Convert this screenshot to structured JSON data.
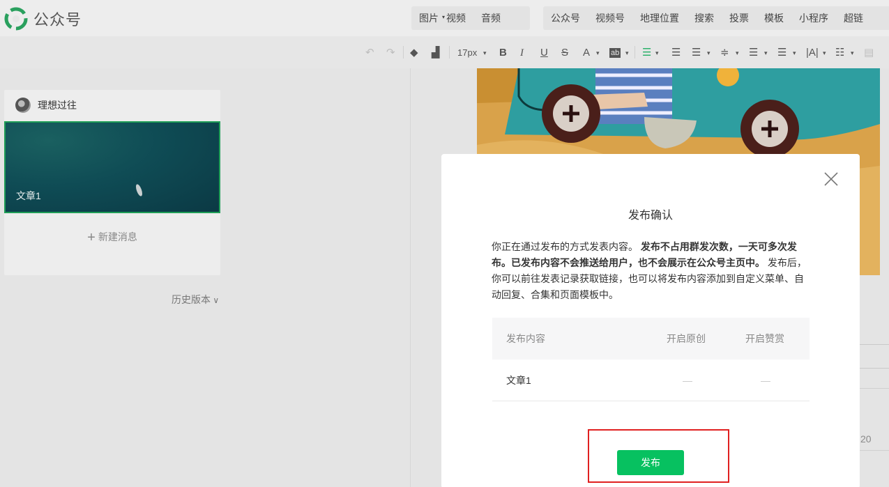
{
  "app": {
    "title": "公众号"
  },
  "topmenu": {
    "group1": [
      "图片",
      "视频",
      "音频"
    ],
    "group2": [
      "公众号",
      "视频号",
      "地理位置",
      "搜索",
      "投票",
      "模板",
      "小程序",
      "超链"
    ]
  },
  "toolbar": {
    "font_size": "17px"
  },
  "sidebar": {
    "account_name": "理想过往",
    "article_title": "文章1",
    "new_message": "新建消息",
    "history": "历史版本"
  },
  "editor": {
    "side_number": "20"
  },
  "modal": {
    "title": "发布确认",
    "desc_part1": "你正在通过发布的方式发表内容。",
    "desc_bold": "发布不占用群发次数，一天可多次发布。已发布内容不会推送给用户，也不会展示在公众号主页中。",
    "desc_part2": "发布后，你可以前往发表记录获取链接，也可以将发布内容添加到自定义菜单、自动回复、合集和页面模板中。",
    "table": {
      "headers": [
        "发布内容",
        "开启原创",
        "开启赞赏"
      ],
      "row": {
        "content": "文章1",
        "original": "—",
        "reward": "—"
      }
    },
    "publish_label": "发布"
  },
  "colors": {
    "accent": "#07c160",
    "highlight": "#e02020",
    "selected_border": "#1f9e57"
  }
}
